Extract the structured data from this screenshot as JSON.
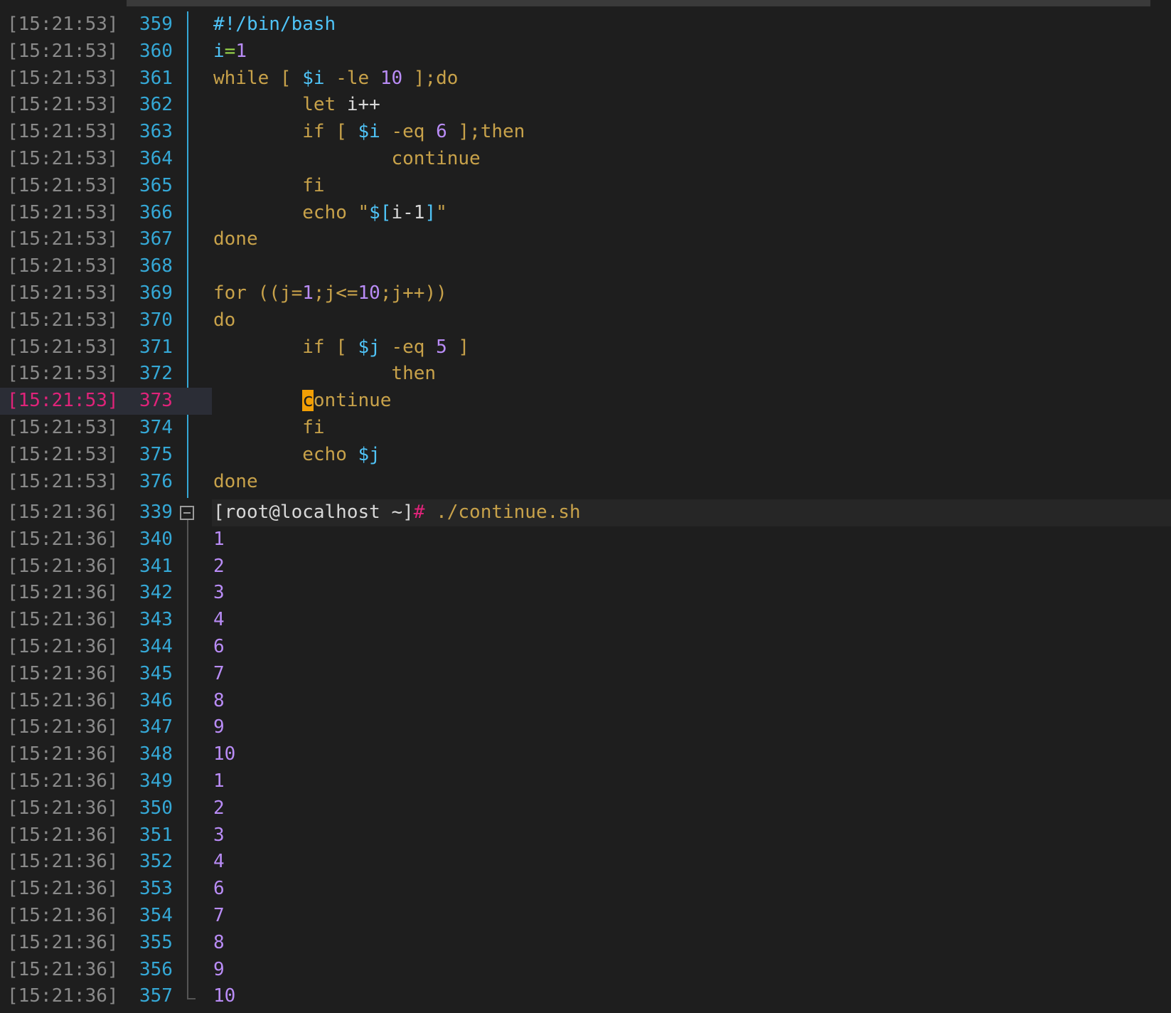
{
  "colors": {
    "background": "#1e1e1e",
    "line_number": "#35a8d6",
    "timestamp": "#8a8a8a",
    "current_line": "#e0237a",
    "keyword": "#c8a24a",
    "variable": "#4fc3f7",
    "number": "#b98cf6",
    "cursor": "#f29f05"
  },
  "editor": {
    "lines": [
      {
        "ts": "[15:21:53]",
        "ln": "359"
      },
      {
        "ts": "[15:21:53]",
        "ln": "360"
      },
      {
        "ts": "[15:21:53]",
        "ln": "361"
      },
      {
        "ts": "[15:21:53]",
        "ln": "362"
      },
      {
        "ts": "[15:21:53]",
        "ln": "363"
      },
      {
        "ts": "[15:21:53]",
        "ln": "364"
      },
      {
        "ts": "[15:21:53]",
        "ln": "365"
      },
      {
        "ts": "[15:21:53]",
        "ln": "366"
      },
      {
        "ts": "[15:21:53]",
        "ln": "367"
      },
      {
        "ts": "[15:21:53]",
        "ln": "368"
      },
      {
        "ts": "[15:21:53]",
        "ln": "369"
      },
      {
        "ts": "[15:21:53]",
        "ln": "370"
      },
      {
        "ts": "[15:21:53]",
        "ln": "371"
      },
      {
        "ts": "[15:21:53]",
        "ln": "372"
      },
      {
        "ts": "[15:21:53]",
        "ln": "373"
      },
      {
        "ts": "[15:21:53]",
        "ln": "374"
      },
      {
        "ts": "[15:21:53]",
        "ln": "375"
      },
      {
        "ts": "[15:21:53]",
        "ln": "376"
      }
    ],
    "code": {
      "l359": "#!/bin/bash",
      "l360_a": "i",
      "l360_b": "=",
      "l360_c": "1",
      "l361_a": "while [ ",
      "l361_b": "$i",
      "l361_c": " -le ",
      "l361_d": "10",
      "l361_e": " ];do",
      "l362_a": "let ",
      "l362_b": "i++",
      "l363_a": "if [ ",
      "l363_b": "$i",
      "l363_c": " -eq ",
      "l363_d": "6",
      "l363_e": " ];then",
      "l364": "continue",
      "l365": "fi",
      "l366_a": "echo \"",
      "l366_b": "$[",
      "l366_c": "i-1",
      "l366_d": "]",
      "l366_e": "\"",
      "l367": "done",
      "l369_a": "for ((",
      "l369_b": "j=",
      "l369_c": "1",
      "l369_d": ";j<=",
      "l369_e": "10",
      "l369_f": ";j++))",
      "l370": "do",
      "l371_a": "if [ ",
      "l371_b": "$j",
      "l371_c": " -eq ",
      "l371_d": "5",
      "l371_e": " ]",
      "l372": "then",
      "l373_cursor": "c",
      "l373_rest": "ontinue",
      "l374": "fi",
      "l375_a": "echo ",
      "l375_b": "$j",
      "l376": "done"
    }
  },
  "terminal": {
    "prompt": {
      "ts": "[15:21:36]",
      "ln": "339",
      "user": "[root@localhost ~]",
      "hash": "#",
      "command": " ./continue.sh"
    },
    "lines": [
      {
        "ts": "[15:21:36]",
        "ln": "340",
        "out": "1"
      },
      {
        "ts": "[15:21:36]",
        "ln": "341",
        "out": "2"
      },
      {
        "ts": "[15:21:36]",
        "ln": "342",
        "out": "3"
      },
      {
        "ts": "[15:21:36]",
        "ln": "343",
        "out": "4"
      },
      {
        "ts": "[15:21:36]",
        "ln": "344",
        "out": "6"
      },
      {
        "ts": "[15:21:36]",
        "ln": "345",
        "out": "7"
      },
      {
        "ts": "[15:21:36]",
        "ln": "346",
        "out": "8"
      },
      {
        "ts": "[15:21:36]",
        "ln": "347",
        "out": "9"
      },
      {
        "ts": "[15:21:36]",
        "ln": "348",
        "out": "10"
      },
      {
        "ts": "[15:21:36]",
        "ln": "349",
        "out": "1"
      },
      {
        "ts": "[15:21:36]",
        "ln": "350",
        "out": "2"
      },
      {
        "ts": "[15:21:36]",
        "ln": "351",
        "out": "3"
      },
      {
        "ts": "[15:21:36]",
        "ln": "352",
        "out": "4"
      },
      {
        "ts": "[15:21:36]",
        "ln": "353",
        "out": "6"
      },
      {
        "ts": "[15:21:36]",
        "ln": "354",
        "out": "7"
      },
      {
        "ts": "[15:21:36]",
        "ln": "355",
        "out": "8"
      },
      {
        "ts": "[15:21:36]",
        "ln": "356",
        "out": "9"
      },
      {
        "ts": "[15:21:36]",
        "ln": "357",
        "out": "10"
      }
    ]
  }
}
